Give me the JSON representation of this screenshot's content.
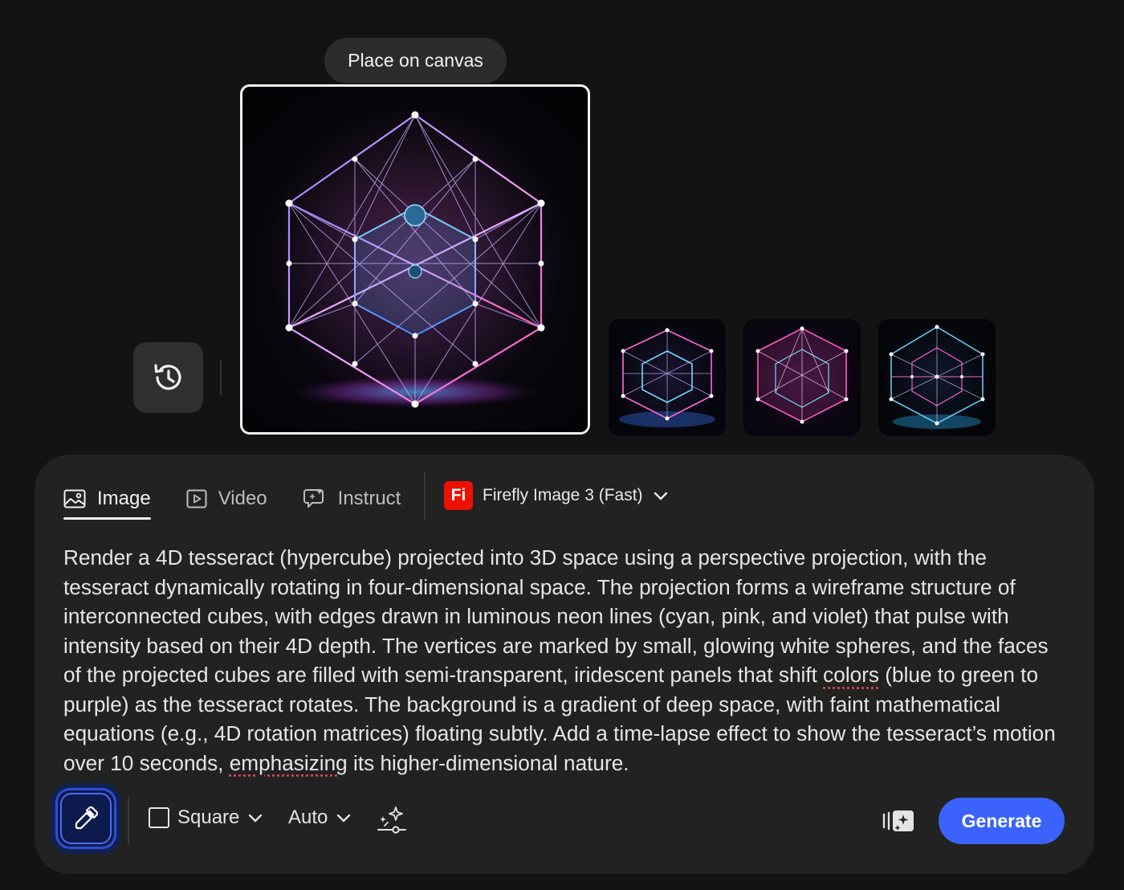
{
  "place_on_canvas_label": "Place on canvas",
  "history_button_icon": "history-icon",
  "tabs": [
    {
      "label": "Image",
      "icon": "image-icon",
      "active": true
    },
    {
      "label": "Video",
      "icon": "video-play-icon",
      "active": false
    },
    {
      "label": "Instruct",
      "icon": "instruct-chat-icon",
      "active": false
    }
  ],
  "model": {
    "logo_text": "Fi",
    "label": "Firefly Image 3 (Fast)",
    "logo_color": "#eb1000"
  },
  "prompt": {
    "text_part1": "Render a 4D tesseract (hypercube) projected into 3D space using a perspective projection, with the tesseract dynamically rotating in four-dimensional space. The projection forms a wireframe structure of interconnected cubes, with edges drawn in luminous neon lines (cyan, pink, and violet) that pulse with intensity based on their 4D depth. The vertices are marked by small, glowing white spheres, and the faces of the projected cubes are filled with semi-transparent, iridescent panels that shift ",
    "word_colors": "colors",
    "text_part2": " (blue to green to purple) as the tesseract rotates. The background is a gradient of deep space, with faint mathematical equations (e.g., 4D rotation matrices) floating subtly. Add a time-lapse effect to show the tesseract’s motion over 10 seconds, ",
    "word_emphasizing": "emphasizing",
    "text_part3": " its higher-dimensional nature."
  },
  "toolbar": {
    "aspect_label": "Square",
    "content_type_label": "Auto",
    "generate_label": "Generate"
  },
  "colors": {
    "accent": "#3b63fb",
    "panel": "#222222",
    "background": "#131313"
  }
}
